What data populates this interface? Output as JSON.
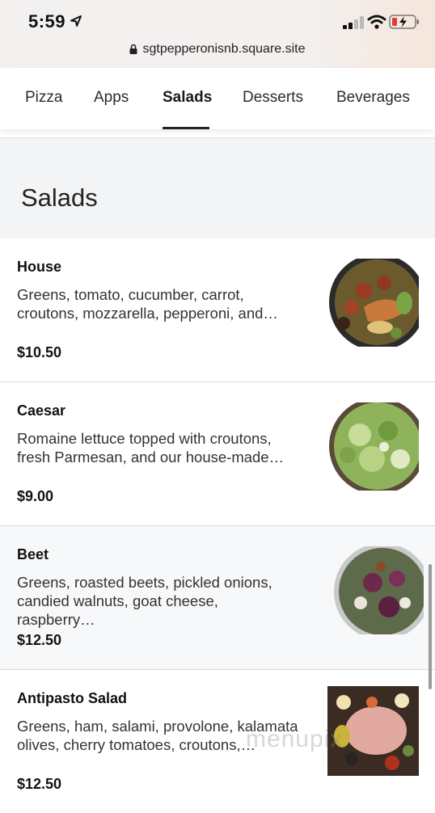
{
  "status_bar": {
    "time": "5:59",
    "url": "sgtpepperonisnb.square.site"
  },
  "tabs": [
    {
      "label": "Pizza"
    },
    {
      "label": "Apps"
    },
    {
      "label": "Salads",
      "active": true
    },
    {
      "label": "Desserts"
    },
    {
      "label": "Beverages"
    }
  ],
  "section": {
    "title": "Salads"
  },
  "items": [
    {
      "name": "House",
      "description": "Greens, tomato, cucumber, carrot, croutons, mozzarella, pepperoni, and…",
      "price": "$10.50",
      "photo": "house-salad-photo"
    },
    {
      "name": "Caesar",
      "description": "Romaine lettuce topped with croutons, fresh Parmesan, and our house-made…",
      "price": "$9.00",
      "photo": "caesar-salad-photo"
    },
    {
      "name": "Beet",
      "description": "Greens, roasted beets, pickled onions, candied walnuts, goat cheese, raspberry…",
      "price": "$12.50",
      "photo": "beet-salad-photo"
    },
    {
      "name": "Antipasto Salad",
      "description": "Greens, ham, salami, provolone, kalamata olives, cherry tomatoes, croutons,…",
      "price": "$12.50",
      "photo": "antipasto-salad-photo"
    }
  ],
  "watermark": "menupix",
  "colors": {
    "accent": "#222222",
    "section_bg": "#f3f4f6",
    "text": "#1b1b1b"
  }
}
